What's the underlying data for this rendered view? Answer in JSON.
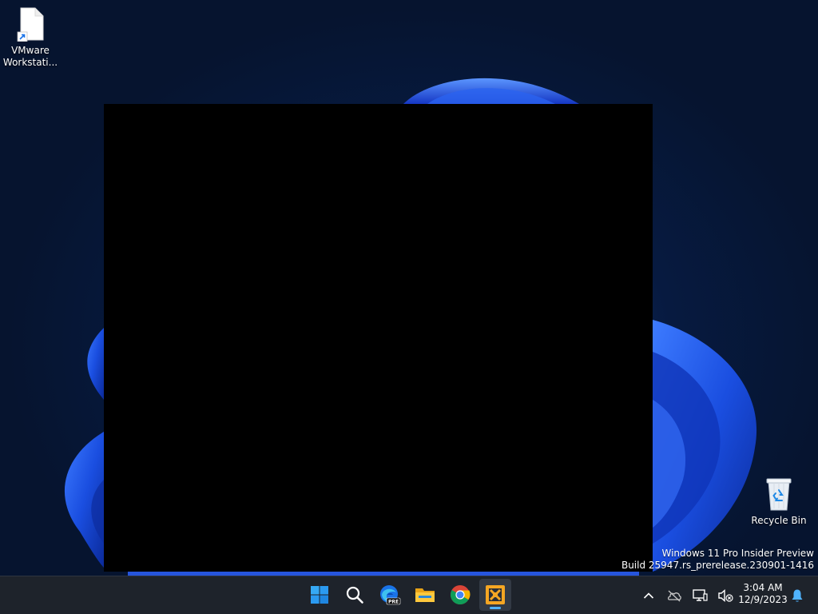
{
  "desktop": {
    "icons": [
      {
        "label": "VMware Workstati...",
        "icon": "file-shortcut-icon"
      },
      {
        "label": "Recycle Bin",
        "icon": "recycle-bin-icon"
      }
    ],
    "watermark": {
      "line1": "Windows 11 Pro Insider Preview",
      "line2": "Build 25947.rs_prerelease.230901-1416"
    }
  },
  "window": {
    "state": "blank-black"
  },
  "taskbar": {
    "pins": [
      {
        "name": "Start",
        "icon": "windows-logo-icon"
      },
      {
        "name": "Search",
        "icon": "search-icon"
      },
      {
        "name": "Microsoft Edge Insider",
        "icon": "edge-pre-icon",
        "badge": "PRE"
      },
      {
        "name": "File Explorer",
        "icon": "folder-icon"
      },
      {
        "name": "Google Chrome",
        "icon": "chrome-icon"
      },
      {
        "name": "VMware Workstation",
        "icon": "vmware-icon",
        "active": true
      }
    ],
    "tray": {
      "icons": [
        "chevron-up-icon",
        "cloud-offline-icon",
        "network-icon",
        "volume-muted-icon",
        "notification-bell-icon"
      ],
      "time": "3:04 AM",
      "date": "12/9/2023"
    }
  },
  "colors": {
    "taskbar_bg": "#1e232b",
    "accent": "#4fb3ff",
    "vmware_orange": "#f5a623"
  }
}
